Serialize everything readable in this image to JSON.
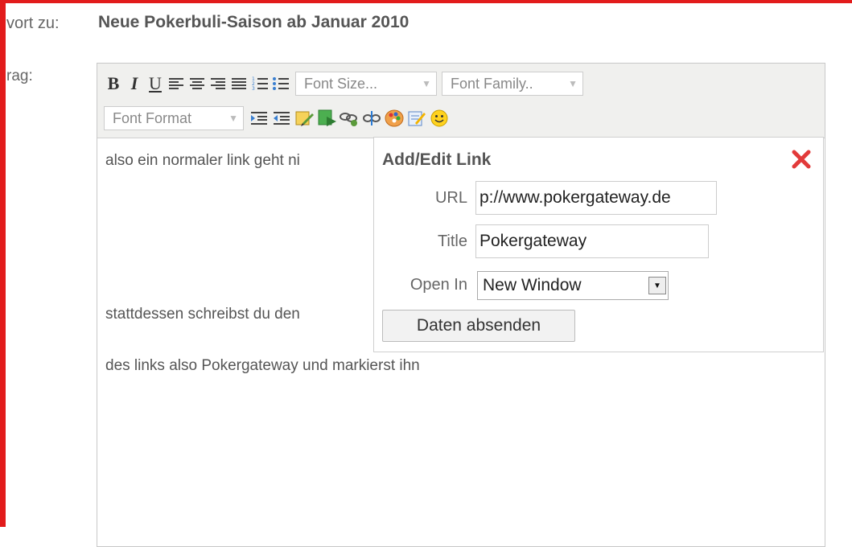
{
  "form": {
    "reply_label": "vort zu:",
    "reply_title": "Neue Pokerbuli-Saison ab Januar 2010",
    "body_label": "rag:"
  },
  "toolbar": {
    "bold": "B",
    "italic": "I",
    "underline": "U",
    "font_size": "Font Size...",
    "font_family": "Font Family..",
    "font_format": "Font Format",
    "icons": [
      "bold-icon",
      "italic-icon",
      "underline-icon",
      "align-left-icon",
      "align-center-icon",
      "align-right-icon",
      "align-justify-icon",
      "ordered-list-icon",
      "unordered-list-icon",
      "indent-icon",
      "outdent-icon",
      "edit-image-icon",
      "insert-image-icon",
      "link-icon",
      "unlink-icon",
      "color-palette-icon",
      "edit-icon",
      "smiley-icon"
    ]
  },
  "content": {
    "line1": "also ein normaler link geht ni",
    "line2": "stattdessen schreibst du den",
    "line3": "des links also Pokergateway und markierst ihn"
  },
  "dialog": {
    "title": "Add/Edit Link",
    "url_label": "URL",
    "url_value": "p://www.pokergateway.de",
    "title_label": "Title",
    "title_value": "Pokergateway",
    "open_in_label": "Open In",
    "open_in_value": "New Window",
    "submit_label": "Daten absenden"
  },
  "colors": {
    "frame": "#e21b1b",
    "close": "#e23a3a"
  }
}
